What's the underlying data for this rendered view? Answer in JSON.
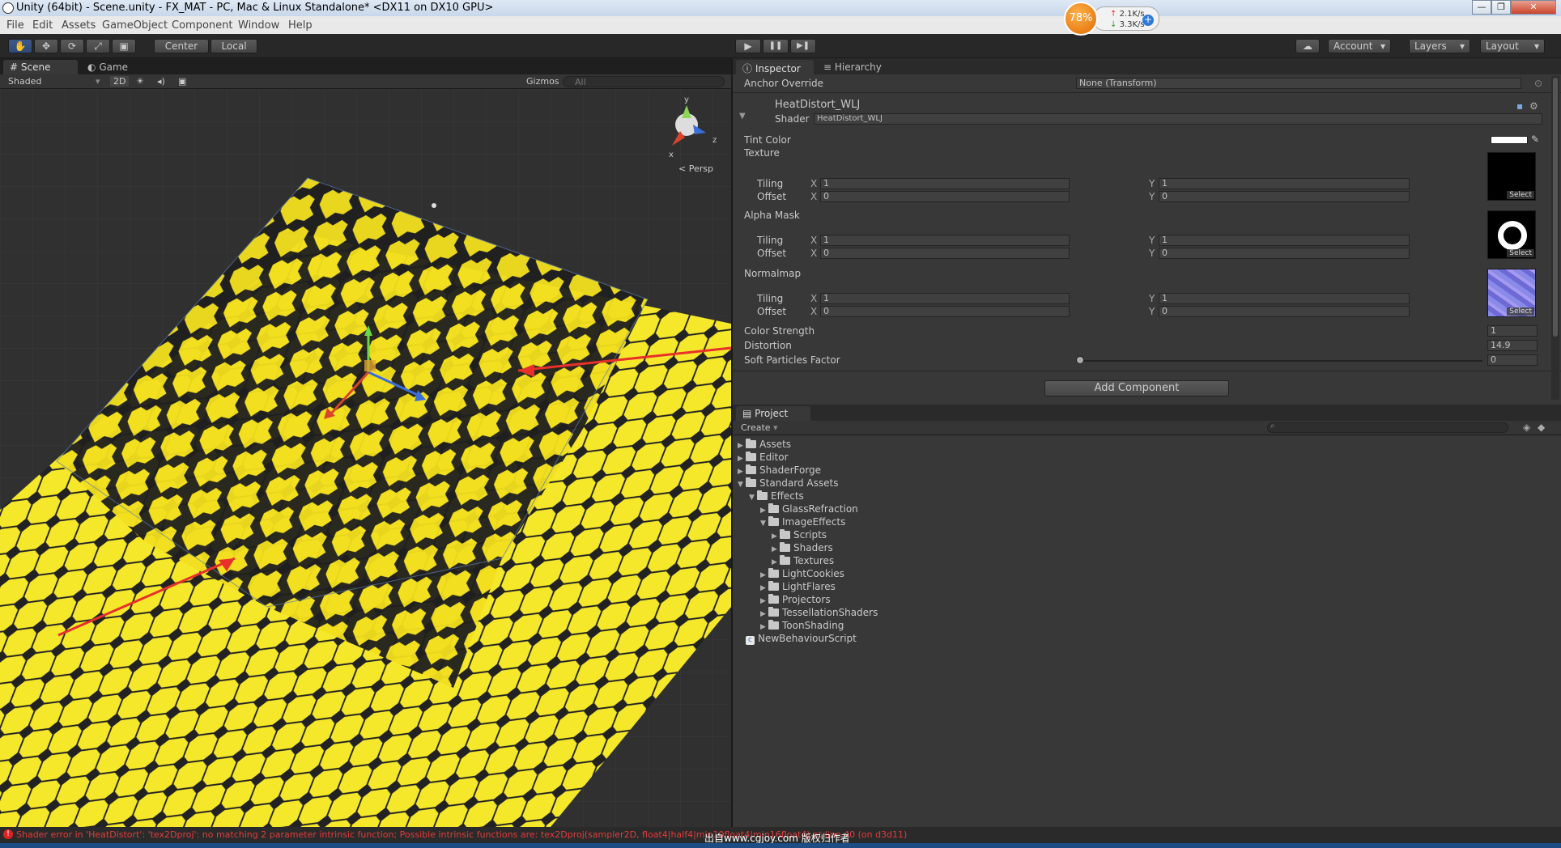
{
  "window": {
    "title": "Unity (64bit) - Scene.unity - FX_MAT - PC, Mac & Linux Standalone* <DX11 on DX10 GPU>",
    "buttons": [
      "—",
      "❐",
      "✕"
    ]
  },
  "net_widget": {
    "percent": "78%",
    "up": "2.1K/s",
    "down": "3.3K/s",
    "up_arrow": "↑",
    "down_arrow": "↓",
    "plus": "+"
  },
  "menu": [
    "File",
    "Edit",
    "Assets",
    "GameObject",
    "Component",
    "Window",
    "Help"
  ],
  "toolbar": {
    "pivot": "Center",
    "space": "Local",
    "account": "Account",
    "layers": "Layers",
    "layout": "Layout",
    "dropdown_caret": "▾",
    "hand_tool": "✋",
    "move_tool": "✥",
    "rotate_tool": "⟳",
    "scale_tool": "⤢",
    "rect_tool": "▣",
    "play": "▶",
    "pause": "❚❚",
    "step": "▶❚",
    "cloud": "☁"
  },
  "scene": {
    "tabs": [
      "Scene",
      "Game"
    ],
    "shading": "Shaded",
    "mode_2d": "2D",
    "gizmos": "Gizmos",
    "search_placeholder": "All",
    "persp_label": "Persp",
    "axis_labels": {
      "x": "x",
      "y": "y",
      "z": "z"
    }
  },
  "inspector": {
    "tabs": [
      "Inspector",
      "Hierarchy"
    ],
    "anchor_override_label": "Anchor Override",
    "anchor_override_value": "None (Transform)",
    "material_name": "HeatDistort_WLJ",
    "shader_label": "Shader",
    "shader_value": "HeatDistort_WLJ",
    "tint_color_label": "Tint Color",
    "texture_label": "Texture",
    "alpha_mask_label": "Alpha Mask",
    "normalmap_label": "Normalmap",
    "tiling_label": "Tiling",
    "offset_label": "Offset",
    "x_label": "X",
    "y_label": "Y",
    "texture_tiling": [
      "1",
      "1"
    ],
    "texture_offset": [
      "0",
      "0"
    ],
    "alpha_tiling": [
      "1",
      "1"
    ],
    "alpha_offset": [
      "0",
      "0"
    ],
    "normal_tiling": [
      "1",
      "1"
    ],
    "normal_offset": [
      "0",
      "0"
    ],
    "select_label": "Select",
    "color_strength_label": "Color Strength",
    "color_strength_value": "1",
    "distortion_label": "Distortion",
    "distortion_value": "14.9",
    "soft_particles_label": "Soft Particles Factor",
    "soft_particles_value": "0",
    "soft_particles_level": 0.0,
    "add_component": "Add Component"
  },
  "project": {
    "tab": "Project",
    "create": "Create",
    "tree": [
      {
        "label": "Assets",
        "depth": 0,
        "open": false
      },
      {
        "label": "Editor",
        "depth": 0,
        "open": false
      },
      {
        "label": "ShaderForge",
        "depth": 0,
        "open": false
      },
      {
        "label": "Standard Assets",
        "depth": 0,
        "open": true
      },
      {
        "label": "Effects",
        "depth": 1,
        "open": true
      },
      {
        "label": "GlassRefraction",
        "depth": 2,
        "open": false
      },
      {
        "label": "ImageEffects",
        "depth": 2,
        "open": true
      },
      {
        "label": "Scripts",
        "depth": 3,
        "open": false
      },
      {
        "label": "Shaders",
        "depth": 3,
        "open": false
      },
      {
        "label": "Textures",
        "depth": 3,
        "open": false
      },
      {
        "label": "LightCookies",
        "depth": 2,
        "open": false
      },
      {
        "label": "LightFlares",
        "depth": 2,
        "open": false
      },
      {
        "label": "Projectors",
        "depth": 2,
        "open": false
      },
      {
        "label": "TessellationShaders",
        "depth": 2,
        "open": false
      },
      {
        "label": "ToonShading",
        "depth": 2,
        "open": false
      }
    ],
    "script_item": "NewBehaviourScript"
  },
  "status": {
    "error": "Shader error in 'HeatDistort': 'tex2Dproj': no matching 2 parameter intrinsic function; Possible intrinsic functions are: tex2Dproj(sampler2D, float4|half4|min10float4|min16float4) at line 40 (on d3d11)",
    "watermark": "出自www.cgjoy.com 版权归作者",
    "error_icon": "!"
  },
  "colors": {
    "accent": "#3e5a8a",
    "error": "#e33c3c",
    "hex_yellow": "#f5e72a",
    "arrow_red": "#e8302a"
  }
}
